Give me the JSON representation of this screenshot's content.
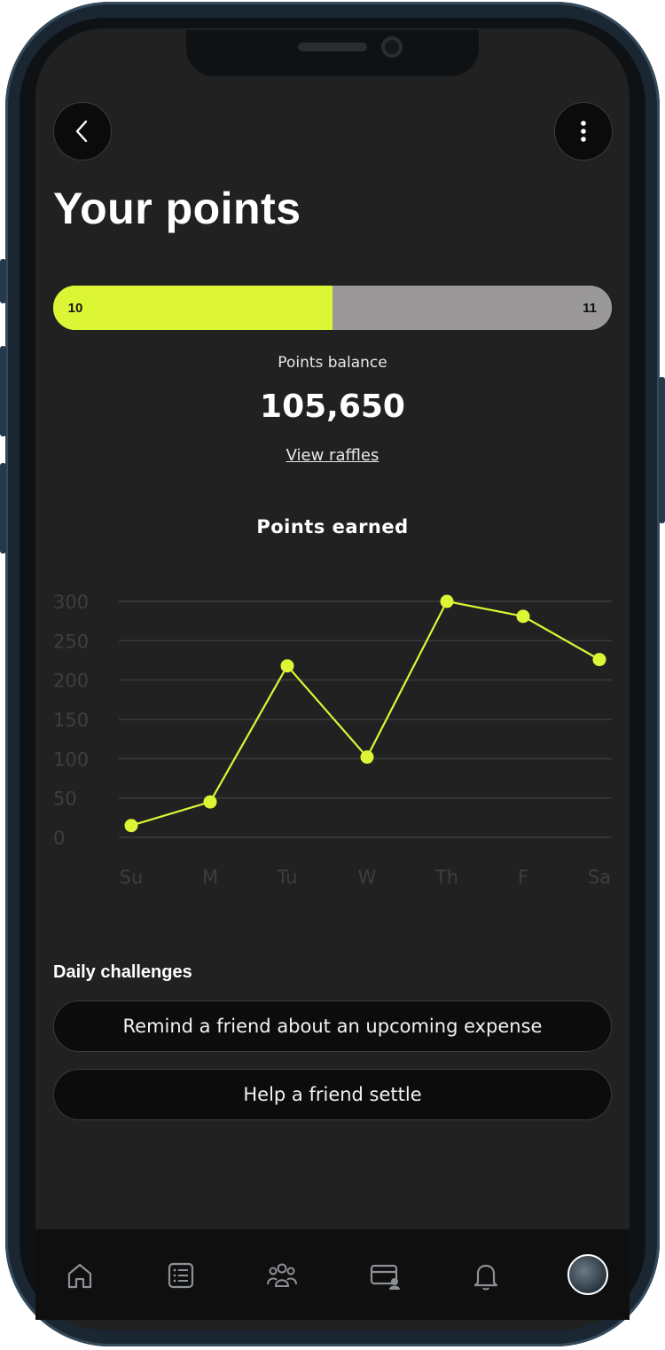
{
  "header": {
    "title": "Your points",
    "back_icon": "chevron-left-icon",
    "more_icon": "more-vertical-icon"
  },
  "level": {
    "current": "10",
    "next": "11",
    "progress": 0.5,
    "fill_color": "#dcf636",
    "track_color": "#9a9899"
  },
  "balance": {
    "label": "Points balance",
    "value": "105,650",
    "link": "View raffles"
  },
  "chart_data": {
    "type": "line",
    "title": "Points earned",
    "categories": [
      "Su",
      "M",
      "Tu",
      "W",
      "Th",
      "F",
      "Sa"
    ],
    "values": [
      15,
      45,
      218,
      102,
      300,
      281,
      226
    ],
    "yticks": [
      0,
      50,
      100,
      150,
      200,
      250,
      300
    ],
    "ylim": [
      0,
      300
    ],
    "grid": true,
    "color": "#dcf636"
  },
  "challenges": {
    "title": "Daily challenges",
    "items": [
      "Remind a friend about an upcoming expense",
      "Help a friend settle"
    ]
  },
  "tabbar": {
    "items": [
      "home-icon",
      "list-icon",
      "friends-icon",
      "wallet-icon",
      "bell-icon",
      "avatar"
    ]
  }
}
